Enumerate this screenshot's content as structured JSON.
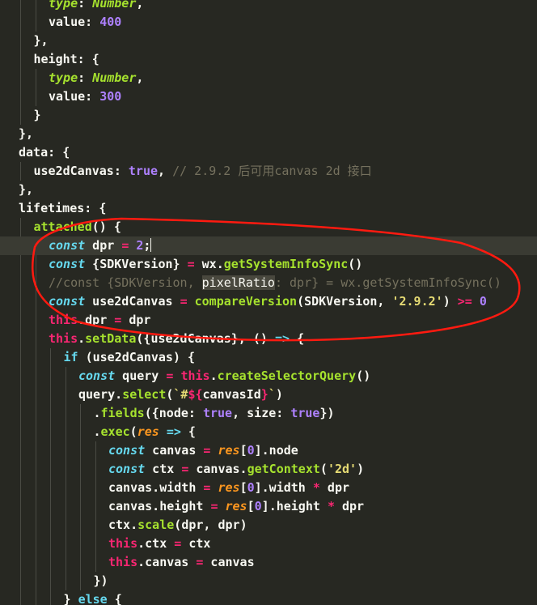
{
  "colors": {
    "background": "#272822",
    "current_line": "#3a3b33",
    "annotation_stroke": "#ff1a10",
    "tokens": {
      "plain": "#f8f8f2",
      "key": "#f8f8f2",
      "punct": "#f8f8f2",
      "prop": "#f8f8f2",
      "type": "#a6e22e",
      "kw": "#66d9ef",
      "storage": "#66d9ef",
      "num": "#ae81ff",
      "bool": "#ae81ff",
      "str": "#e6db74",
      "comment": "#75715e",
      "func": "#a6e22e",
      "method": "#a6e22e",
      "op": "#f92672",
      "this": "#f92672",
      "param": "#fd971f",
      "tpl": "#e6db74",
      "brace": "#f8f8f2",
      "hl": "#f8f8f2"
    }
  },
  "editor": {
    "current_line_index": 13,
    "cursor": {
      "line": 13,
      "after_token": 6
    },
    "lines": [
      {
        "indent": 3,
        "tokens": [
          [
            "type",
            "type"
          ],
          [
            "key",
            ": "
          ],
          [
            "type",
            "Number"
          ],
          [
            "punct",
            ","
          ]
        ]
      },
      {
        "indent": 3,
        "tokens": [
          [
            "key",
            "value: "
          ],
          [
            "num",
            "400"
          ]
        ]
      },
      {
        "indent": 2,
        "tokens": [
          [
            "brace",
            "}"
          ],
          [
            "punct",
            ","
          ]
        ]
      },
      {
        "indent": 2,
        "tokens": [
          [
            "key",
            "height: "
          ],
          [
            "brace",
            "{"
          ]
        ]
      },
      {
        "indent": 3,
        "tokens": [
          [
            "type",
            "type"
          ],
          [
            "key",
            ": "
          ],
          [
            "type",
            "Number"
          ],
          [
            "punct",
            ","
          ]
        ]
      },
      {
        "indent": 3,
        "tokens": [
          [
            "key",
            "value: "
          ],
          [
            "num",
            "300"
          ]
        ]
      },
      {
        "indent": 2,
        "tokens": [
          [
            "brace",
            "}"
          ]
        ]
      },
      {
        "indent": 1,
        "tokens": [
          [
            "brace",
            "}"
          ],
          [
            "punct",
            ","
          ]
        ]
      },
      {
        "indent": 1,
        "tokens": [
          [
            "key",
            "data: "
          ],
          [
            "brace",
            "{"
          ]
        ]
      },
      {
        "indent": 2,
        "tokens": [
          [
            "key",
            "use2dCanvas: "
          ],
          [
            "bool",
            "true"
          ],
          [
            "punct",
            ", "
          ],
          [
            "comment",
            "// 2.9.2 后可用canvas 2d 接口"
          ]
        ]
      },
      {
        "indent": 1,
        "tokens": [
          [
            "brace",
            "}"
          ],
          [
            "punct",
            ","
          ]
        ]
      },
      {
        "indent": 1,
        "tokens": [
          [
            "key",
            "lifetimes: "
          ],
          [
            "brace",
            "{"
          ]
        ]
      },
      {
        "indent": 2,
        "tokens": [
          [
            "func",
            "attached"
          ],
          [
            "punct",
            "() "
          ],
          [
            "brace",
            "{"
          ]
        ]
      },
      {
        "indent": 3,
        "tokens": [
          [
            "storage",
            "const"
          ],
          [
            "plain",
            " dpr "
          ],
          [
            "op",
            "="
          ],
          [
            "plain",
            " "
          ],
          [
            "num",
            "2"
          ],
          [
            "punct",
            ";"
          ]
        ]
      },
      {
        "indent": 3,
        "tokens": [
          [
            "storage",
            "const"
          ],
          [
            "plain",
            " {SDKVersion} "
          ],
          [
            "op",
            "="
          ],
          [
            "plain",
            " wx."
          ],
          [
            "method",
            "getSystemInfoSync"
          ],
          [
            "punct",
            "()"
          ]
        ]
      },
      {
        "indent": 3,
        "tokens": [
          [
            "comment",
            "//const {SDKVersion, "
          ],
          [
            "hl",
            "pixelRatio"
          ],
          [
            "comment",
            ": dpr} = wx.getSystemInfoSync()"
          ]
        ]
      },
      {
        "indent": 3,
        "tokens": [
          [
            "storage",
            "const"
          ],
          [
            "plain",
            " use2dCanvas "
          ],
          [
            "op",
            "="
          ],
          [
            "plain",
            " "
          ],
          [
            "func",
            "compareVersion"
          ],
          [
            "punct",
            "("
          ],
          [
            "plain",
            "SDKVersion, "
          ],
          [
            "str",
            "'2.9.2'"
          ],
          [
            "punct",
            ") "
          ],
          [
            "op",
            ">="
          ],
          [
            "plain",
            " "
          ],
          [
            "num",
            "0"
          ]
        ]
      },
      {
        "indent": 3,
        "tokens": [
          [
            "this",
            "this"
          ],
          [
            "plain",
            ".dpr "
          ],
          [
            "op",
            "="
          ],
          [
            "plain",
            " dpr"
          ]
        ]
      },
      {
        "indent": 3,
        "tokens": [
          [
            "this",
            "this"
          ],
          [
            "plain",
            "."
          ],
          [
            "method",
            "setData"
          ],
          [
            "punct",
            "({"
          ],
          [
            "plain",
            "use2dCanvas"
          ],
          [
            "punct",
            "}, () "
          ],
          [
            "storage",
            "=>"
          ],
          [
            "plain",
            " "
          ],
          [
            "brace",
            "{"
          ]
        ]
      },
      {
        "indent": 4,
        "tokens": [
          [
            "kw",
            "if"
          ],
          [
            "plain",
            " (use2dCanvas) "
          ],
          [
            "brace",
            "{"
          ]
        ]
      },
      {
        "indent": 5,
        "tokens": [
          [
            "storage",
            "const"
          ],
          [
            "plain",
            " query "
          ],
          [
            "op",
            "="
          ],
          [
            "plain",
            " "
          ],
          [
            "this",
            "this"
          ],
          [
            "plain",
            "."
          ],
          [
            "method",
            "createSelectorQuery"
          ],
          [
            "punct",
            "()"
          ]
        ]
      },
      {
        "indent": 5,
        "tokens": [
          [
            "plain",
            "query."
          ],
          [
            "method",
            "select"
          ],
          [
            "punct",
            "("
          ],
          [
            "tpl",
            "`#"
          ],
          [
            "op",
            "${"
          ],
          [
            "plain",
            "canvasId"
          ],
          [
            "op",
            "}"
          ],
          [
            "tpl",
            "`"
          ],
          [
            "punct",
            ")"
          ]
        ]
      },
      {
        "indent": 6,
        "tokens": [
          [
            "plain",
            "."
          ],
          [
            "method",
            "fields"
          ],
          [
            "punct",
            "({"
          ],
          [
            "plain",
            "node: "
          ],
          [
            "bool",
            "true"
          ],
          [
            "plain",
            ", size: "
          ],
          [
            "bool",
            "true"
          ],
          [
            "punct",
            "})"
          ]
        ]
      },
      {
        "indent": 6,
        "tokens": [
          [
            "plain",
            "."
          ],
          [
            "method",
            "exec"
          ],
          [
            "punct",
            "("
          ],
          [
            "param",
            "res"
          ],
          [
            "plain",
            " "
          ],
          [
            "storage",
            "=>"
          ],
          [
            "plain",
            " "
          ],
          [
            "brace",
            "{"
          ]
        ]
      },
      {
        "indent": 7,
        "tokens": [
          [
            "storage",
            "const"
          ],
          [
            "plain",
            " canvas "
          ],
          [
            "op",
            "="
          ],
          [
            "plain",
            " "
          ],
          [
            "param",
            "res"
          ],
          [
            "punct",
            "["
          ],
          [
            "num",
            "0"
          ],
          [
            "punct",
            "]"
          ],
          [
            "plain",
            ".node"
          ]
        ]
      },
      {
        "indent": 7,
        "tokens": [
          [
            "storage",
            "const"
          ],
          [
            "plain",
            " ctx "
          ],
          [
            "op",
            "="
          ],
          [
            "plain",
            " canvas."
          ],
          [
            "method",
            "getContext"
          ],
          [
            "punct",
            "("
          ],
          [
            "str",
            "'2d'"
          ],
          [
            "punct",
            ")"
          ]
        ]
      },
      {
        "indent": 7,
        "tokens": [
          [
            "plain",
            "canvas.width "
          ],
          [
            "op",
            "="
          ],
          [
            "plain",
            " "
          ],
          [
            "param",
            "res"
          ],
          [
            "punct",
            "["
          ],
          [
            "num",
            "0"
          ],
          [
            "punct",
            "]"
          ],
          [
            "plain",
            ".width "
          ],
          [
            "op",
            "*"
          ],
          [
            "plain",
            " dpr"
          ]
        ]
      },
      {
        "indent": 7,
        "tokens": [
          [
            "plain",
            "canvas.height "
          ],
          [
            "op",
            "="
          ],
          [
            "plain",
            " "
          ],
          [
            "param",
            "res"
          ],
          [
            "punct",
            "["
          ],
          [
            "num",
            "0"
          ],
          [
            "punct",
            "]"
          ],
          [
            "plain",
            ".height "
          ],
          [
            "op",
            "*"
          ],
          [
            "plain",
            " dpr"
          ]
        ]
      },
      {
        "indent": 7,
        "tokens": [
          [
            "plain",
            "ctx."
          ],
          [
            "method",
            "scale"
          ],
          [
            "punct",
            "("
          ],
          [
            "plain",
            "dpr, dpr"
          ],
          [
            "punct",
            ")"
          ]
        ]
      },
      {
        "indent": 7,
        "tokens": [
          [
            "this",
            "this"
          ],
          [
            "plain",
            ".ctx "
          ],
          [
            "op",
            "="
          ],
          [
            "plain",
            " ctx"
          ]
        ]
      },
      {
        "indent": 7,
        "tokens": [
          [
            "this",
            "this"
          ],
          [
            "plain",
            ".canvas "
          ],
          [
            "op",
            "="
          ],
          [
            "plain",
            " canvas"
          ]
        ]
      },
      {
        "indent": 6,
        "tokens": [
          [
            "brace",
            "}"
          ],
          [
            "punct",
            ")"
          ]
        ]
      },
      {
        "indent": 4,
        "tokens": [
          [
            "brace",
            "}"
          ],
          [
            "plain",
            " "
          ],
          [
            "kw",
            "else"
          ],
          [
            "plain",
            " "
          ],
          [
            "brace",
            "{"
          ]
        ]
      }
    ]
  }
}
